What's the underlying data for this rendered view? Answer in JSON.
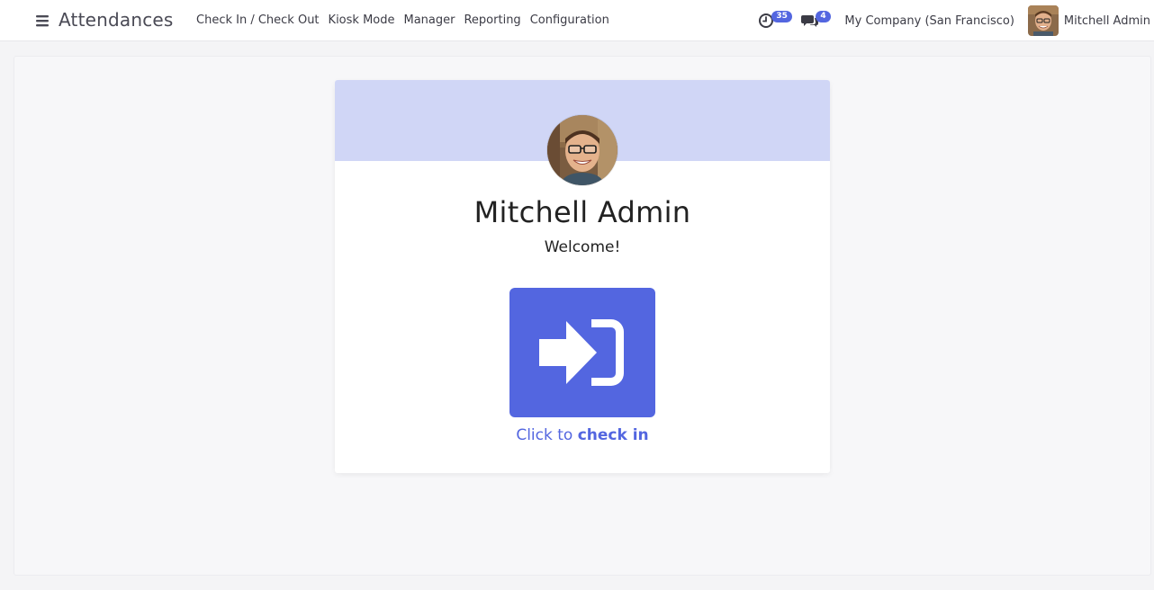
{
  "navbar": {
    "app_title": "Attendances",
    "menu": [
      {
        "label": "Check In / Check Out"
      },
      {
        "label": "Kiosk Mode"
      },
      {
        "label": "Manager"
      },
      {
        "label": "Reporting"
      },
      {
        "label": "Configuration"
      }
    ],
    "activity_badge": "35",
    "messages_badge": "4",
    "company": "My Company (San Francisco)",
    "user_name": "Mitchell Admin"
  },
  "card": {
    "employee_name": "Mitchell Admin",
    "welcome": "Welcome!",
    "caption_prefix": "Click to",
    "caption_action": "check in"
  },
  "colors": {
    "accent": "#5366e0",
    "header_band": "#d0d6f6",
    "background": "#f7f7f9"
  },
  "icons": {
    "menu_toggle": "hamburger-icon",
    "activity": "clock-icon",
    "messages": "chat-bubbles-icon",
    "checkin": "sign-in-icon"
  }
}
